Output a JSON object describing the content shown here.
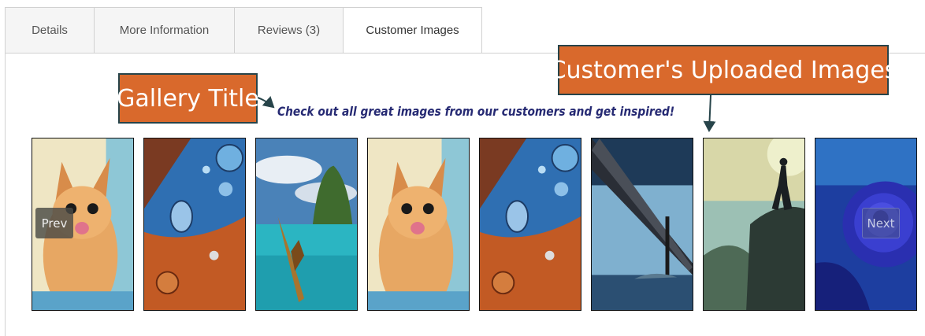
{
  "tabs": [
    {
      "label": "Details",
      "active": false
    },
    {
      "label": "More Information",
      "active": false
    },
    {
      "label": "Reviews (3)",
      "active": false
    },
    {
      "label": "Customer Images",
      "active": true
    }
  ],
  "annotations": {
    "gallery_title_label": "Gallery Title",
    "uploaded_images_label": "Customer's Uploaded Images",
    "color": "#d9692c",
    "border_color": "#27444a"
  },
  "gallery": {
    "title": "Check out all great images from our customers and get inspired!",
    "title_color": "#262a73",
    "prev_label": "Prev",
    "next_label": "Next",
    "images": [
      "kitten",
      "water-drops",
      "boat-island",
      "kitten",
      "water-drops",
      "bridge",
      "hiker-silhouette",
      "blue-rose"
    ]
  }
}
